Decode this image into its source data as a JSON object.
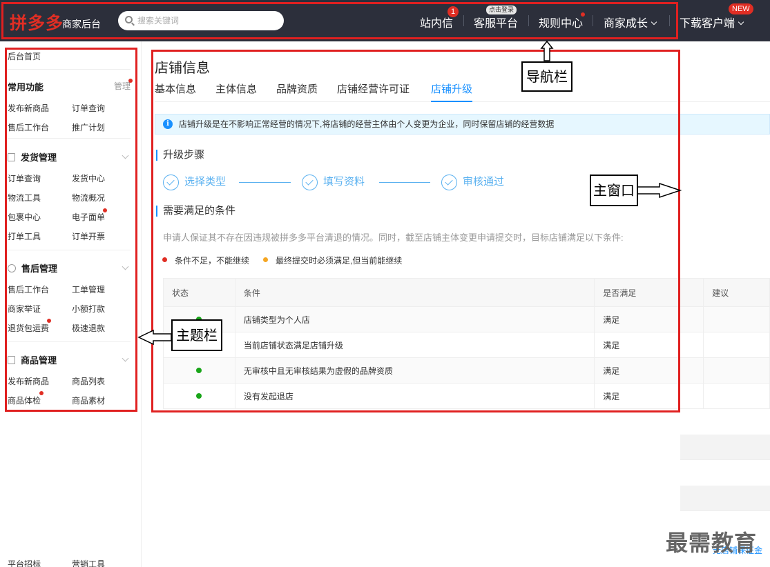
{
  "brand": {
    "logo": "拼多多",
    "subtitle": "商家后台"
  },
  "search": {
    "placeholder": "搜索关键词"
  },
  "nav": {
    "inbox": "站内信",
    "inbox_badge": "1",
    "service": "客服平台",
    "service_tag": "点击登录",
    "rules": "规则中心",
    "growth": "商家成长",
    "download": "下载客户端",
    "download_badge": "NEW"
  },
  "sidebar": {
    "home": "后台首页",
    "common": {
      "title": "常用功能",
      "manage": "管理",
      "links": [
        "发布新商品",
        "订单查询",
        "售后工作台",
        "推广计划"
      ]
    },
    "shipping": {
      "title": "发货管理",
      "links": [
        "订单查询",
        "发货中心",
        "物流工具",
        "物流概况",
        "包裹中心",
        "电子面单",
        "打单工具",
        "订单开票"
      ]
    },
    "aftersale": {
      "title": "售后管理",
      "links": [
        "售后工作台",
        "工单管理",
        "商家举证",
        "小额打款",
        "退货包运费",
        "极速退款"
      ]
    },
    "goods": {
      "title": "商品管理",
      "links": [
        "发布新商品",
        "商品列表",
        "商品体检",
        "商品素材"
      ]
    },
    "bottom": [
      "平台招标",
      "营销工具"
    ]
  },
  "main": {
    "title": "店铺信息",
    "tabs": [
      "基本信息",
      "主体信息",
      "品牌资质",
      "店铺经营许可证",
      "店铺升级"
    ],
    "notice": "店铺升级是在不影响正常经营的情况下,将店铺的经营主体由个人变更为企业，同时保留店铺的经营数据",
    "steps_title": "升级步骤",
    "steps": [
      "选择类型",
      "填写资料",
      "审核通过"
    ],
    "conditions_title": "需要满足的条件",
    "desc": "申请人保证其不存在因违规被拼多多平台清退的情况。同时，截至店铺主体变更申请提交时，目标店铺满足以下条件:",
    "legend": [
      "条件不足，不能继续",
      "最终提交时必须满足,但当前能继续"
    ],
    "table": {
      "headers": [
        "状态",
        "条件",
        "是否满足",
        "建议"
      ],
      "rows": [
        {
          "condition": "店铺类型为个人店",
          "met": "满足"
        },
        {
          "condition": "当前店铺状态满足店铺升级",
          "met": "满足"
        },
        {
          "condition": "无审核中且无审核结果为虚假的品牌资质",
          "met": "满足"
        },
        {
          "condition": "没有发起退店",
          "met": "满足"
        }
      ]
    },
    "bottom_link": "无店铺保证金"
  },
  "annotations": {
    "nav": "导航栏",
    "main": "主窗口",
    "sidebar": "主题栏"
  },
  "watermark": "最需教育",
  "colors": {
    "topbar": "#2c2f3b",
    "brand_red": "#e02e24",
    "accent_blue": "#1890ff",
    "ok_green": "#19a519",
    "annotation_red": "#e02020",
    "legend_orange": "#f5a623"
  }
}
